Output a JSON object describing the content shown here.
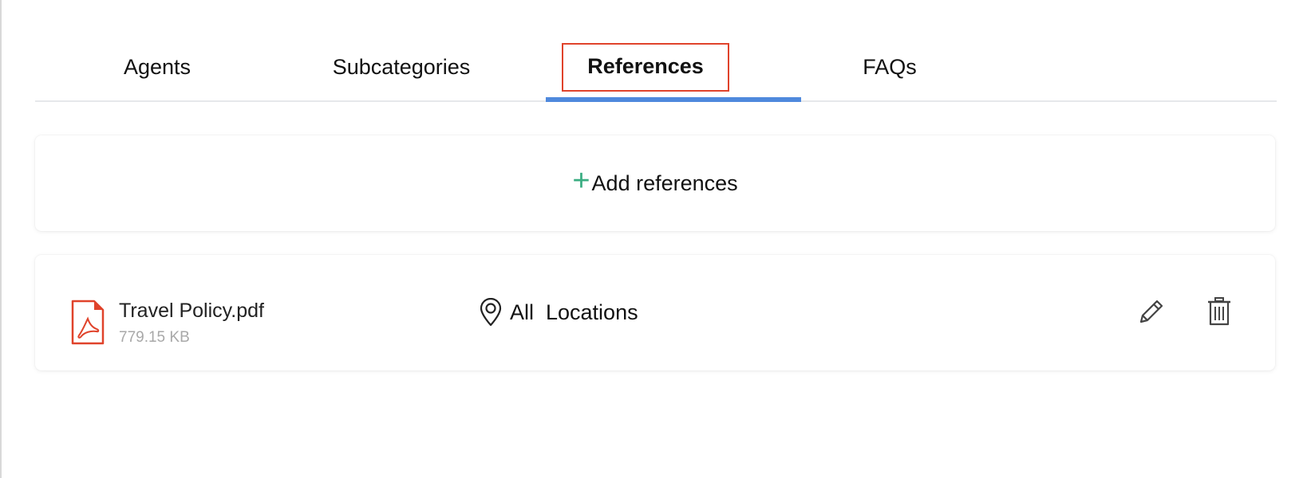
{
  "tabs": [
    {
      "label": "Agents",
      "active": false
    },
    {
      "label": "Subcategories",
      "active": false
    },
    {
      "label": "References",
      "active": true
    },
    {
      "label": "FAQs",
      "active": false
    }
  ],
  "add_references": {
    "icon": "plus-icon",
    "label": "Add references",
    "icon_color": "#3aad82"
  },
  "references": [
    {
      "file_icon": "pdf-file-icon",
      "file_name": "Travel Policy.pdf",
      "file_size": "779.15 KB",
      "location_icon": "location-pin-icon",
      "location": "All  Locations",
      "actions": [
        "edit-icon",
        "delete-icon"
      ]
    }
  ],
  "colors": {
    "active_tab_underline": "#4f89dd",
    "active_tab_highlight": "#e0432b",
    "pdf_icon": "#e0432b"
  }
}
